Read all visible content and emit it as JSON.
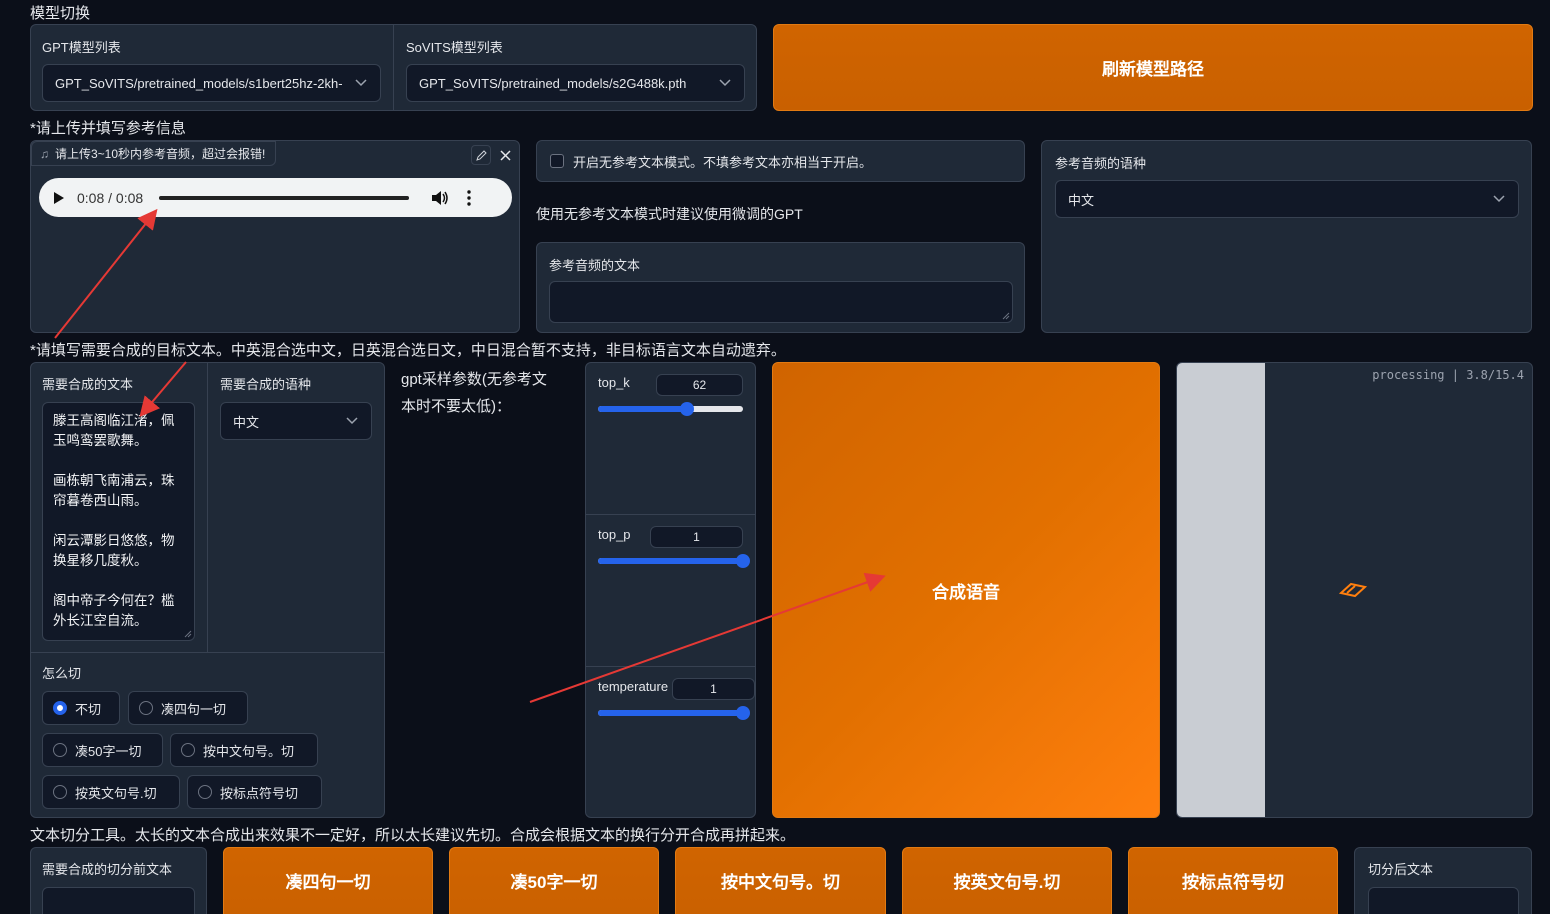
{
  "model_switch": {
    "title": "模型切换",
    "gpt_label": "GPT模型列表",
    "gpt_value": "GPT_SoVITS/pretrained_models/s1bert25hz-2kh-",
    "sovits_label": "SoVITS模型列表",
    "sovits_value": "GPT_SoVITS/pretrained_models/s2G488k.pth",
    "refresh_button": "刷新模型路径"
  },
  "reference": {
    "title": "*请上传并填写参考信息",
    "audio_label": "请上传3~10秒内参考音频，超过会报错!",
    "audio_time": "0:08 / 0:08",
    "audio_progress": 1.0,
    "no_ref_checkbox": "开启无参考文本模式。不填参考文本亦相当于开启。",
    "no_ref_hint": "使用无参考文本模式时建议使用微调的GPT",
    "ref_text_label": "参考音频的文本",
    "ref_text_value": "",
    "ref_lang_label": "参考音频的语种",
    "ref_lang_value": "中文"
  },
  "target": {
    "title": "*请填写需要合成的目标文本。中英混合选中文，日英混合选日文，中日混合暂不支持，非目标语言文本自动遗弃。",
    "text_label": "需要合成的文本",
    "text_lines": [
      "滕王高阁临江渚，佩",
      "玉鸣鸾罢歌舞。",
      "",
      "画栋朝飞南浦云，珠",
      "帘暮卷西山雨。",
      "",
      "闲云潭影日悠悠，物",
      "换星移几度秋。",
      "",
      "阁中帝子今何在？槛",
      "外长江空自流。"
    ],
    "lang_label": "需要合成的语种",
    "lang_value": "中文",
    "cut_label": "怎么切",
    "cut_options": [
      "不切",
      "凑四句一切",
      "凑50字一切",
      "按中文句号。切",
      "按英文句号.切",
      "按标点符号切"
    ],
    "cut_selected": "不切"
  },
  "sampling": {
    "label": "gpt采样参数(无参考文本时不要太低)：",
    "label_line1": "gpt采样参数(无参考文",
    "label_line2": "本时不要太低)：",
    "top_k_label": "top_k",
    "top_k_value": "62",
    "top_k_min": 1,
    "top_k_max": 100,
    "top_p_label": "top_p",
    "top_p_value": "1",
    "top_p_fraction": 1.0,
    "temperature_label": "temperature",
    "temperature_value": "1",
    "temperature_fraction": 1.0
  },
  "synth": {
    "button": "合成语音",
    "status": "processing | 3.8/15.4"
  },
  "split_tool": {
    "title": "文本切分工具。太长的文本合成出来效果不一定好，所以太长建议先切。合成会根据文本的换行分开合成再拼起来。",
    "before_label": "需要合成的切分前文本",
    "buttons": [
      "凑四句一切",
      "凑50字一切",
      "按中文句号。切",
      "按英文句号.切",
      "按标点符号切"
    ],
    "after_label": "切分后文本"
  },
  "colors": {
    "accent_orange": "#d06400",
    "accent_blue": "#2563eb",
    "annotation_red": "#e53935"
  }
}
